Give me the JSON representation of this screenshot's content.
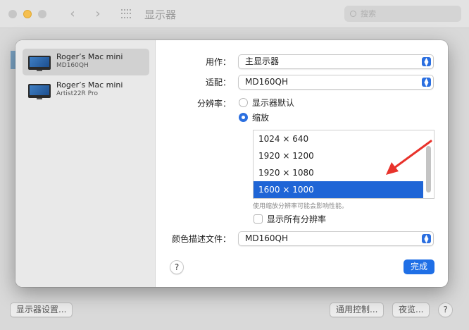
{
  "window": {
    "title": "显示器",
    "search_placeholder": "搜索",
    "bottom_buttons": {
      "display_settings": "显示器设置...",
      "universal_control": "通用控制...",
      "night_shift": "夜览...",
      "help": "?"
    }
  },
  "sidebar": {
    "displays": [
      {
        "name": "Roger’s Mac mini",
        "model": "MD160QH",
        "selected": true
      },
      {
        "name": "Roger’s Mac mini",
        "model": "Artist22R Pro",
        "selected": false
      }
    ]
  },
  "settings": {
    "use_as_label": "用作：",
    "use_as_value": "主显示器",
    "optimize_for_label": "适配：",
    "optimize_for_value": "MD160QH",
    "resolution_label": "分辨率：",
    "resolution_options": [
      {
        "label": "显示器默认",
        "selected": false
      },
      {
        "label": "缩放",
        "selected": true
      }
    ],
    "scaled_resolutions": [
      {
        "label": "1024 × 640",
        "selected": false
      },
      {
        "label": "1920 × 1200",
        "selected": false
      },
      {
        "label": "1920 × 1080",
        "selected": false
      },
      {
        "label": "1600 × 1000",
        "selected": true
      }
    ],
    "performance_hint": "使用缩放分辨率可能会影响性能。",
    "show_all_resolutions_label": "显示所有分辨率",
    "show_all_resolutions_checked": false,
    "color_profile_label": "颜色描述文件：",
    "color_profile_value": "MD160QH"
  },
  "footer": {
    "help": "?",
    "done": "完成"
  },
  "colors": {
    "accent": "#1f6fe6",
    "annotation_arrow": "#e8322b"
  }
}
